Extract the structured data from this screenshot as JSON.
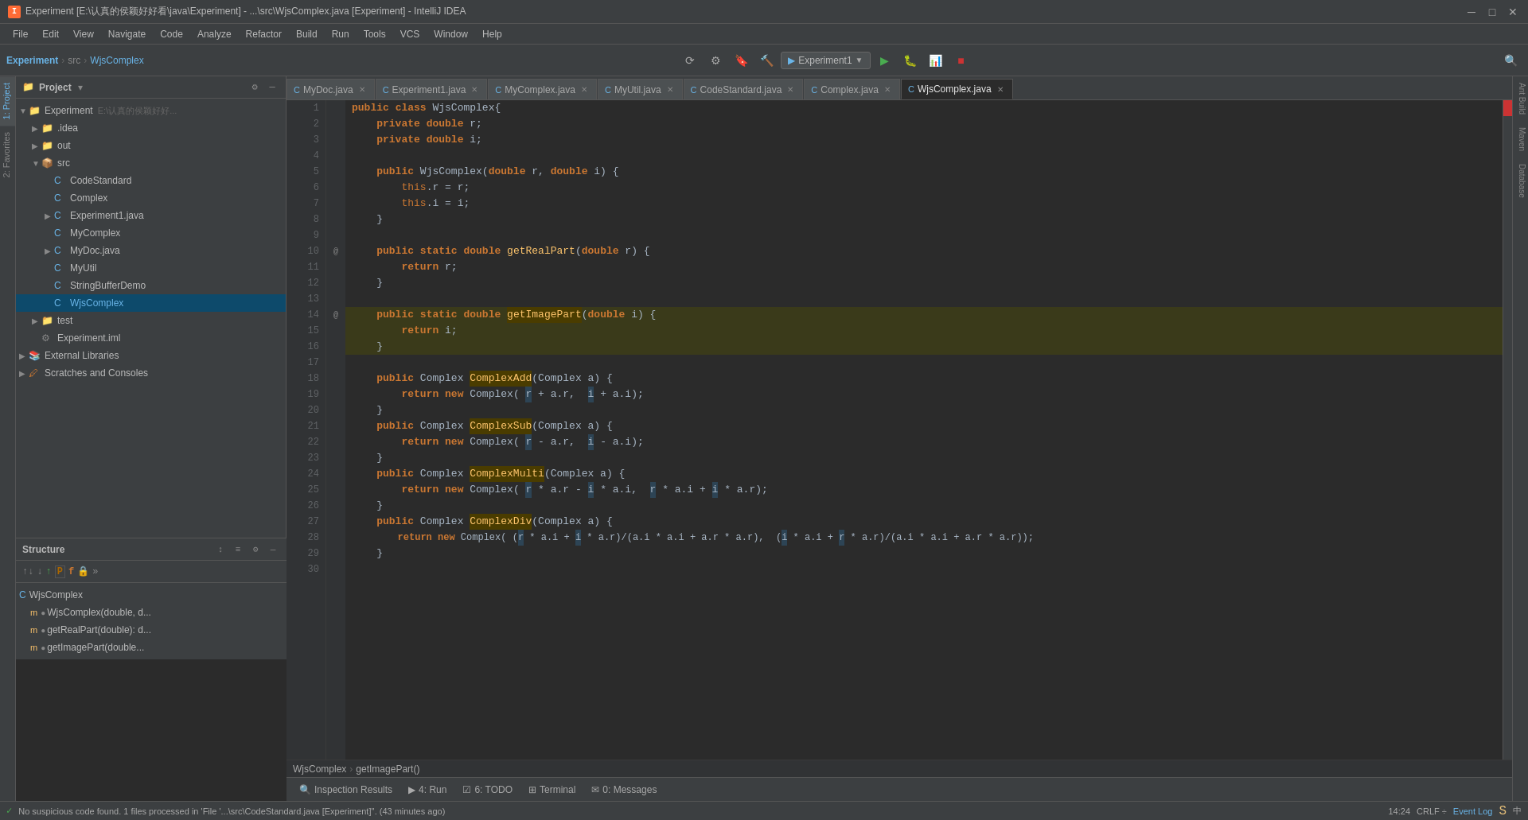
{
  "titlebar": {
    "text": "Experiment [E:\\认真的侯颖好好看\\java\\Experiment] - ...\\src\\WjsComplex.java [Experiment] - IntelliJ IDEA",
    "icon": "●"
  },
  "menu": {
    "items": [
      "File",
      "Edit",
      "View",
      "Navigate",
      "Code",
      "Analyze",
      "Refactor",
      "Build",
      "Run",
      "Tools",
      "VCS",
      "Window",
      "Help"
    ]
  },
  "toolbar": {
    "project": "Experiment",
    "src": "src",
    "file": "WjsComplex",
    "run_config": "Experiment1"
  },
  "project_panel": {
    "title": "Project",
    "root": "Experiment",
    "root_path": "E:\\认真的侯颖好好...",
    "items": [
      {
        "label": ".idea",
        "type": "folder",
        "indent": 1,
        "expanded": false
      },
      {
        "label": "out",
        "type": "folder",
        "indent": 1,
        "expanded": false
      },
      {
        "label": "src",
        "type": "folder",
        "indent": 1,
        "expanded": true
      },
      {
        "label": "CodeStandard",
        "type": "java",
        "indent": 2
      },
      {
        "label": "Complex",
        "type": "java",
        "indent": 2
      },
      {
        "label": "Experiment1.java",
        "type": "java",
        "indent": 2,
        "expanded": false
      },
      {
        "label": "MyComplex",
        "type": "java",
        "indent": 2
      },
      {
        "label": "MyDoc.java",
        "type": "java",
        "indent": 2,
        "expanded": false
      },
      {
        "label": "MyUtil",
        "type": "java",
        "indent": 2
      },
      {
        "label": "StringBufferDemo",
        "type": "java",
        "indent": 2
      },
      {
        "label": "WjsComplex",
        "type": "java",
        "indent": 2,
        "active": true
      },
      {
        "label": "test",
        "type": "folder",
        "indent": 1,
        "expanded": false
      },
      {
        "label": "Experiment.iml",
        "type": "iml",
        "indent": 1
      },
      {
        "label": "External Libraries",
        "type": "ext",
        "indent": 0,
        "expanded": false
      },
      {
        "label": "Scratches and Consoles",
        "type": "console",
        "indent": 0,
        "expanded": false
      }
    ]
  },
  "structure_panel": {
    "title": "Structure",
    "items": [
      {
        "label": "WjsComplex",
        "type": "class",
        "indent": 0
      },
      {
        "label": "WjsComplex(double, d...",
        "type": "method",
        "indent": 1
      },
      {
        "label": "getRealPart(double): d...",
        "type": "method",
        "indent": 1
      },
      {
        "label": "getImagePart(double...",
        "type": "method",
        "indent": 1
      }
    ]
  },
  "file_tabs": [
    {
      "label": "MyDoc.java",
      "active": false
    },
    {
      "label": "Experiment1.java",
      "active": false
    },
    {
      "label": "MyComplex.java",
      "active": false
    },
    {
      "label": "MyUtil.java",
      "active": false
    },
    {
      "label": "CodeStandard.java",
      "active": false
    },
    {
      "label": "Complex.java",
      "active": false
    },
    {
      "label": "WjsComplex.java",
      "active": true
    }
  ],
  "code": {
    "lines": [
      {
        "num": 1,
        "content": "public class WjsComplex{",
        "type": "normal"
      },
      {
        "num": 2,
        "content": "    private double r;",
        "type": "normal"
      },
      {
        "num": 3,
        "content": "    private double i;",
        "type": "normal"
      },
      {
        "num": 4,
        "content": "",
        "type": "normal"
      },
      {
        "num": 5,
        "content": "    public WjsComplex(double r, double i) {",
        "type": "normal"
      },
      {
        "num": 6,
        "content": "        this.r = r;",
        "type": "normal"
      },
      {
        "num": 7,
        "content": "        this.i = i;",
        "type": "normal"
      },
      {
        "num": 8,
        "content": "    }",
        "type": "normal"
      },
      {
        "num": 9,
        "content": "",
        "type": "normal"
      },
      {
        "num": 10,
        "content": "    public static double getRealPart(double r) {",
        "type": "normal",
        "annotation": "@"
      },
      {
        "num": 11,
        "content": "        return r;",
        "type": "normal"
      },
      {
        "num": 12,
        "content": "    }",
        "type": "normal"
      },
      {
        "num": 13,
        "content": "",
        "type": "normal"
      },
      {
        "num": 14,
        "content": "    public static double getImagePart(double i) {",
        "type": "highlighted",
        "annotation": "@"
      },
      {
        "num": 15,
        "content": "        return i;",
        "type": "highlighted"
      },
      {
        "num": 16,
        "content": "    }",
        "type": "highlighted"
      },
      {
        "num": 17,
        "content": "",
        "type": "normal"
      },
      {
        "num": 18,
        "content": "    public Complex ComplexAdd(Complex a) {",
        "type": "normal"
      },
      {
        "num": 19,
        "content": "        return new Complex( r + a.r,  i + a.i);",
        "type": "normal"
      },
      {
        "num": 20,
        "content": "    }",
        "type": "normal"
      },
      {
        "num": 21,
        "content": "    public Complex ComplexSub(Complex a) {",
        "type": "normal"
      },
      {
        "num": 22,
        "content": "        return new Complex( r - a.r,  i - a.i);",
        "type": "normal"
      },
      {
        "num": 23,
        "content": "    }",
        "type": "normal"
      },
      {
        "num": 24,
        "content": "    public Complex ComplexMulti(Complex a) {",
        "type": "normal"
      },
      {
        "num": 25,
        "content": "        return new Complex( r * a.r - i * a.i,  r * a.i + i * a.r);",
        "type": "normal"
      },
      {
        "num": 26,
        "content": "    }",
        "type": "normal"
      },
      {
        "num": 27,
        "content": "    public Complex ComplexDiv(Complex a) {",
        "type": "normal"
      },
      {
        "num": 28,
        "content": "        return new Complex( (r * a.i + i * a.r)/(a.i * a.i + a.r * a.r),  (i * a.i + r * a.r)/(a.i * a.i + a.r * a.r));",
        "type": "normal"
      },
      {
        "num": 29,
        "content": "    }",
        "type": "normal"
      },
      {
        "num": 30,
        "content": "",
        "type": "normal"
      }
    ]
  },
  "breadcrumb": {
    "class": "WjsComplex",
    "method": "getImagePart()"
  },
  "bottom_tabs": [
    {
      "label": "Inspection Results",
      "icon": "🔍"
    },
    {
      "label": "4: Run",
      "icon": "▶"
    },
    {
      "label": "6: TODO",
      "icon": "☑"
    },
    {
      "label": "Terminal",
      "icon": "⊞"
    },
    {
      "label": "0: Messages",
      "icon": "✉"
    }
  ],
  "status_bar": {
    "check_text": "No suspicious code found. 1 files processed in 'File '...\\src\\CodeStandard.java [Experiment]''. (43 minutes ago)",
    "position": "14:24",
    "encoding": "CRLF ÷",
    "event_log": "Event Log"
  }
}
